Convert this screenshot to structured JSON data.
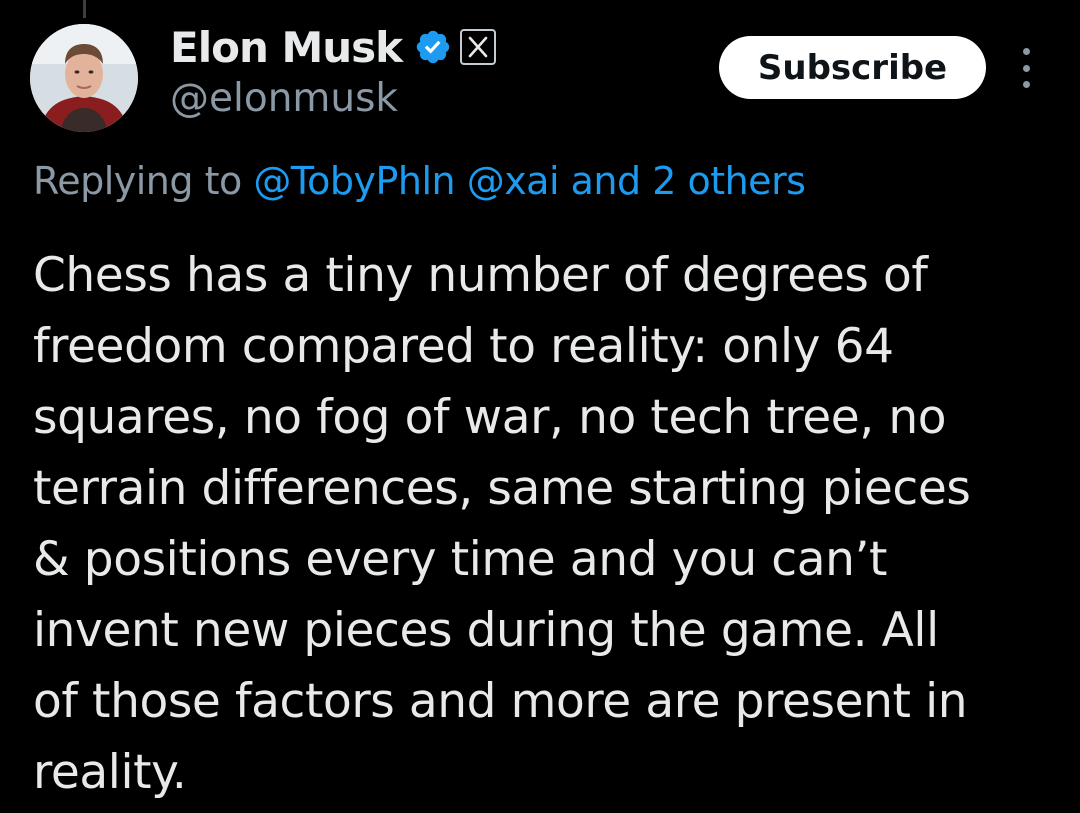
{
  "tweet": {
    "author": {
      "display_name": "Elon Musk",
      "handle": "@elonmusk",
      "avatar": "avatar-photo",
      "verified_icon": "verified-check-icon",
      "affiliation_icon": "x-logo-icon"
    },
    "subscribe_label": "Subscribe",
    "more_icon": "more-vertical-icon",
    "reply_context": {
      "prefix": "Replying to",
      "mentions": [
        "@TobyPhln",
        "@xai"
      ],
      "suffix": "and 2 others"
    },
    "text_lines": [
      "Chess has a tiny number of degrees of",
      "freedom compared to reality: only 64",
      "squares, no fog of war, no tech tree, no",
      "terrain differences, same starting pieces",
      "& positions every time and you can’t",
      "invent new pieces during the game. All",
      "of those factors and more are present in",
      "reality."
    ]
  },
  "colors": {
    "background": "#000000",
    "text_primary": "#e7e9ea",
    "text_secondary": "#8b98a5",
    "link": "#1d9bf0",
    "verified": "#1d9bf0",
    "button_bg": "#ffffff",
    "button_text": "#0f1419"
  }
}
